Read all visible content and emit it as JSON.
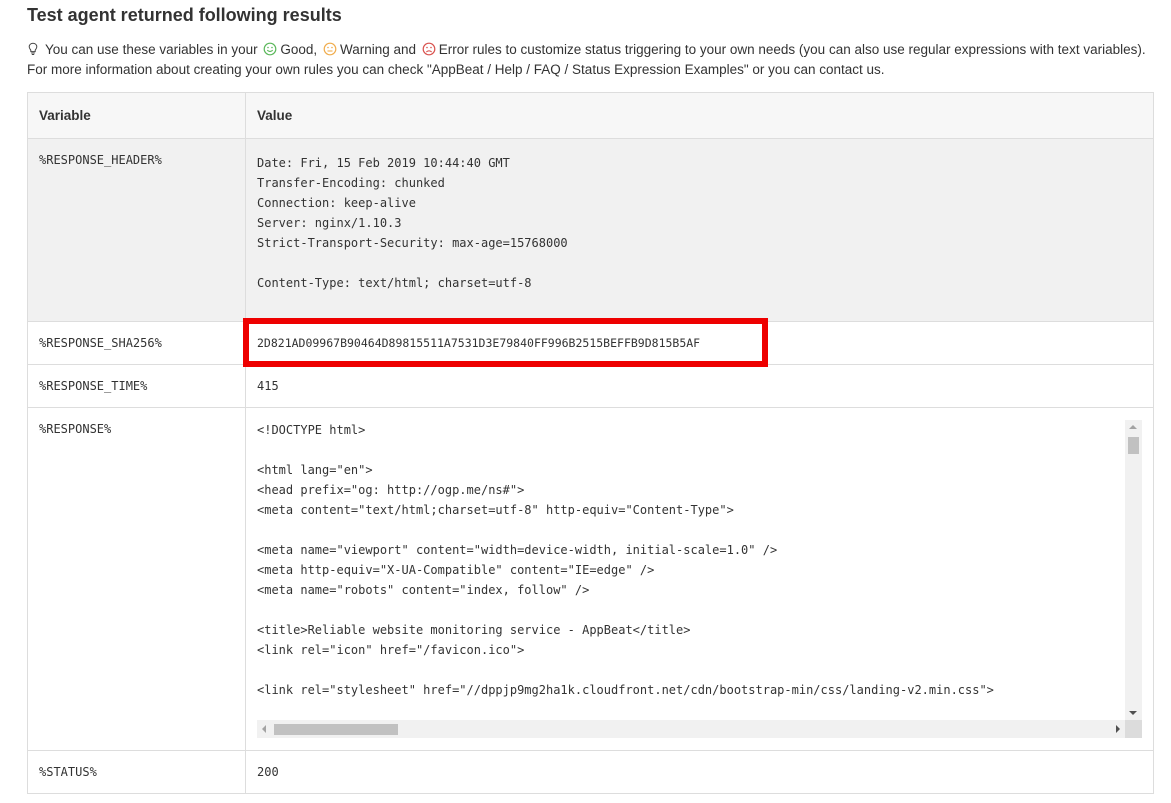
{
  "title": "Test agent returned following results",
  "info": {
    "icon": "lightbulb-icon",
    "part1": "You can use these variables in your",
    "good_label": "Good,",
    "warning_label": "Warning and",
    "error_label": "Error rules to customize status triggering to your own needs (you can also use regular expressions with text variables). For more information about creating your own rules you can check \"AppBeat / Help / FAQ / Status Expression Examples\" or you can contact us.",
    "colors": {
      "good": "#5cb85c",
      "warning": "#f0ad4e",
      "error": "#d9534f"
    }
  },
  "table": {
    "headers": {
      "variable": "Variable",
      "value": "Value"
    },
    "rows": [
      {
        "variable": "%RESPONSE_HEADER%",
        "value": "Date: Fri, 15 Feb 2019 10:44:40 GMT\nTransfer-Encoding: chunked\nConnection: keep-alive\nServer: nginx/1.10.3\nStrict-Transport-Security: max-age=15768000\n\nContent-Type: text/html; charset=utf-8"
      },
      {
        "variable": "%RESPONSE_SHA256%",
        "value": "2D821AD09967B90464D89815511A7531D3E79840FF996B2515BEFFB9D815B5AF",
        "highlight_color": "#ee0000"
      },
      {
        "variable": "%RESPONSE_TIME%",
        "value": "415"
      },
      {
        "variable": "%RESPONSE%",
        "value": "<!DOCTYPE html>\n\n<html lang=\"en\">\n<head prefix=\"og: http://ogp.me/ns#\">\n<meta content=\"text/html;charset=utf-8\" http-equiv=\"Content-Type\">\n\n<meta name=\"viewport\" content=\"width=device-width, initial-scale=1.0\" />\n<meta http-equiv=\"X-UA-Compatible\" content=\"IE=edge\" />\n<meta name=\"robots\" content=\"index, follow\" />\n\n<title>Reliable website monitoring service - AppBeat</title>\n<link rel=\"icon\" href=\"/favicon.ico\">\n\n<link rel=\"stylesheet\" href=\"//dppjp9mg2ha1k.cloudfront.net/cdn/bootstrap-min/css/landing-v2.min.css\">"
      },
      {
        "variable": "%STATUS%",
        "value": "200"
      }
    ]
  }
}
